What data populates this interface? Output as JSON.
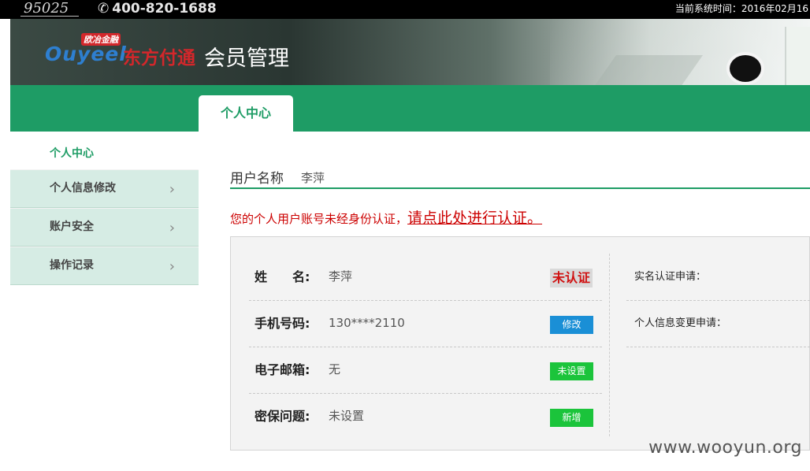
{
  "topbar": {
    "hotline": "95025",
    "phone": "400-820-1688",
    "system_time": "当前系统时间：2016年02月16"
  },
  "header": {
    "logo_en": "Ouyeel",
    "logo_cn": "东方付通",
    "logo_badge": "欧冶金融",
    "title": "会员管理"
  },
  "nav": {
    "tab": "个人中心"
  },
  "sidebar": {
    "heading": "个人中心",
    "items": [
      {
        "label": "个人信息修改"
      },
      {
        "label": "账户安全"
      },
      {
        "label": "操作记录"
      }
    ]
  },
  "main": {
    "username_label": "用户名称",
    "username_value": "李萍",
    "warning_text": "您的个人用户账号未经身份认证，",
    "warning_link": "请点此处进行认证。",
    "rows": [
      {
        "label": "姓　　名:",
        "value": "李萍",
        "badge": "未认证"
      },
      {
        "label": "手机号码:",
        "value": "130****2110",
        "button": "修改"
      },
      {
        "label": "电子邮箱:",
        "value": "无",
        "button": "未设置"
      },
      {
        "label": "密保问题:",
        "value": "未设置",
        "button": "新增"
      }
    ],
    "right_rows": [
      {
        "label": "实名认证申请："
      },
      {
        "label": "个人信息变更申请："
      }
    ]
  },
  "watermark": "www.wooyun.org"
}
